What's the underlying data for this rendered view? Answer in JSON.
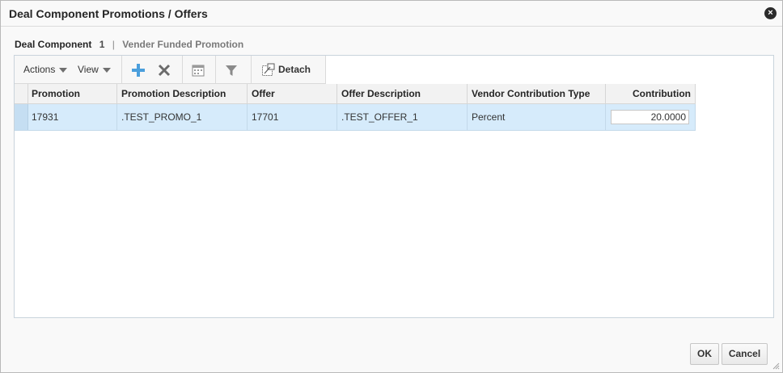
{
  "dialog": {
    "title": "Deal Component Promotions / Offers",
    "close_glyph": "×"
  },
  "subhead": {
    "label": "Deal Component",
    "number": "1",
    "separator": "|",
    "description": "Vender Funded Promotion"
  },
  "toolbar": {
    "actions_label": "Actions",
    "view_label": "View",
    "detach_label": "Detach",
    "icons": [
      "add-icon",
      "delete-icon",
      "calendar-icon",
      "filter-icon",
      "detach-icon"
    ]
  },
  "grid": {
    "columns": [
      "Promotion",
      "Promotion Description",
      "Offer",
      "Offer Description",
      "Vendor Contribution Type",
      "Contribution"
    ],
    "rows": [
      {
        "promotion": "17931",
        "promotion_description": ".TEST_PROMO_1",
        "offer": "17701",
        "offer_description": ".TEST_OFFER_1",
        "vendor_contribution_type": "Percent",
        "contribution": "20.0000"
      }
    ]
  },
  "footer": {
    "ok_label": "OK",
    "cancel_label": "Cancel"
  },
  "colors": {
    "selected_row": "#d6ebfb",
    "add_icon": "#4b9fdc",
    "icon_gray": "#6b6b6b"
  }
}
